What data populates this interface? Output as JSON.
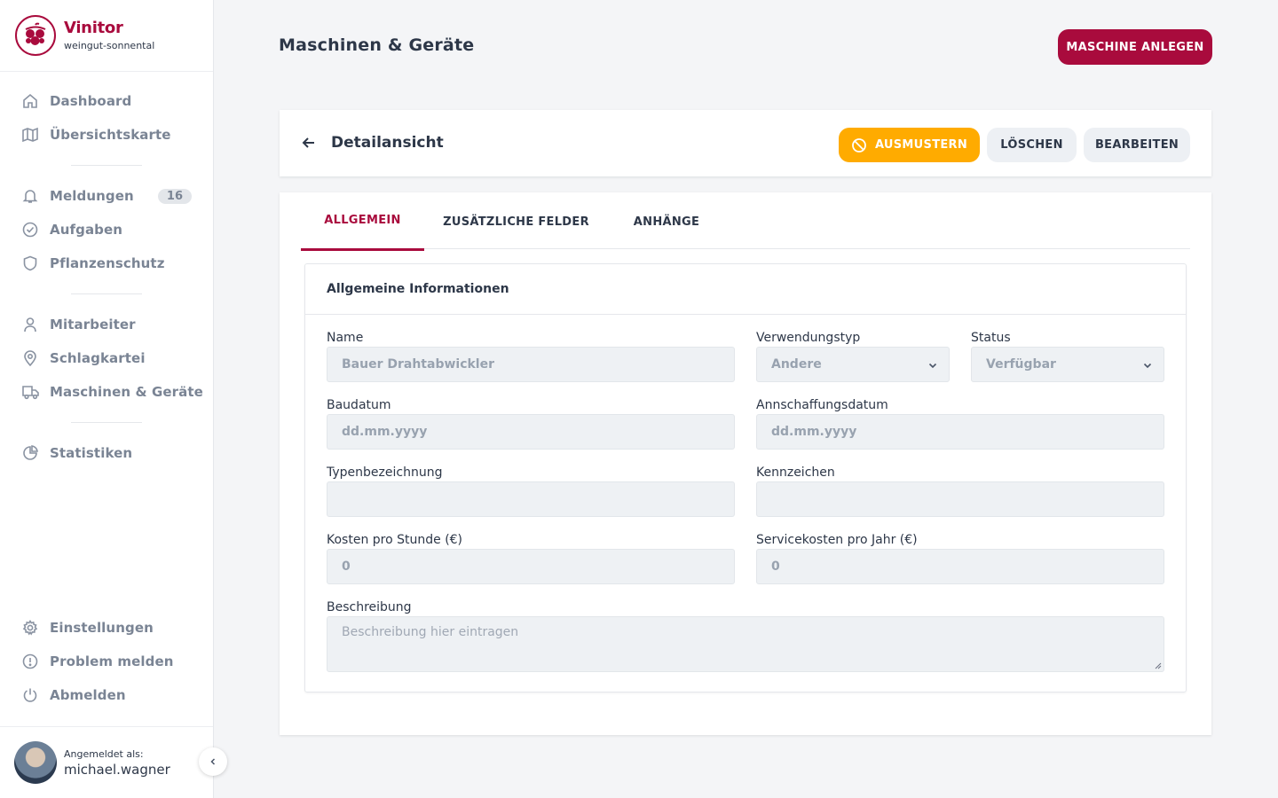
{
  "brand": {
    "name": "Vinitor",
    "subtitle": "weingut-sonnental"
  },
  "nav": {
    "items": [
      {
        "label": "Dashboard"
      },
      {
        "label": "Übersichtskarte"
      },
      {
        "label": "Meldungen",
        "badge": "16"
      },
      {
        "label": "Aufgaben"
      },
      {
        "label": "Pflanzenschutz"
      },
      {
        "label": "Mitarbeiter"
      },
      {
        "label": "Schlagkartei"
      },
      {
        "label": "Maschinen & Geräte"
      },
      {
        "label": "Statistiken"
      }
    ],
    "bottom": [
      {
        "label": "Einstellungen"
      },
      {
        "label": "Problem melden"
      },
      {
        "label": "Abmelden"
      }
    ]
  },
  "user": {
    "label": "Angemeldet als:",
    "name": "michael.wagner"
  },
  "header": {
    "title": "Maschinen & Geräte",
    "primary_button": "MASCHINE ANLEGEN"
  },
  "detail": {
    "title": "Detailansicht",
    "buttons": {
      "retire": "AUSMUSTERN",
      "delete": "LÖSCHEN",
      "edit": "BEARBEITEN"
    }
  },
  "tabs": [
    {
      "label": "ALLGEMEIN",
      "active": true
    },
    {
      "label": "ZUSÄTZLICHE FELDER"
    },
    {
      "label": "ANHÄNGE"
    }
  ],
  "panel": {
    "title": "Allgemeine Informationen",
    "fields": {
      "name": {
        "label": "Name",
        "value": "Bauer Drahtabwickler"
      },
      "usage_type": {
        "label": "Verwendungstyp",
        "value": "Andere"
      },
      "status": {
        "label": "Status",
        "value": "Verfügbar"
      },
      "build_date": {
        "label": "Baudatum",
        "placeholder": "dd.mm.yyyy"
      },
      "purchase_date": {
        "label": "Annschaffungsdatum",
        "placeholder": "dd.mm.yyyy"
      },
      "type_designation": {
        "label": "Typenbezeichnung",
        "value": ""
      },
      "license_plate": {
        "label": "Kennzeichen",
        "value": ""
      },
      "cost_per_hour": {
        "label": "Kosten pro Stunde (€)",
        "value": "0"
      },
      "service_cost": {
        "label": "Servicekosten pro Jahr (€)",
        "value": "0"
      },
      "description": {
        "label": "Beschreibung",
        "placeholder": "Beschreibung hier eintragen"
      }
    }
  },
  "colors": {
    "brand": "#a90b3d",
    "warning": "#ffab00",
    "nav_text": "#7a8494"
  }
}
